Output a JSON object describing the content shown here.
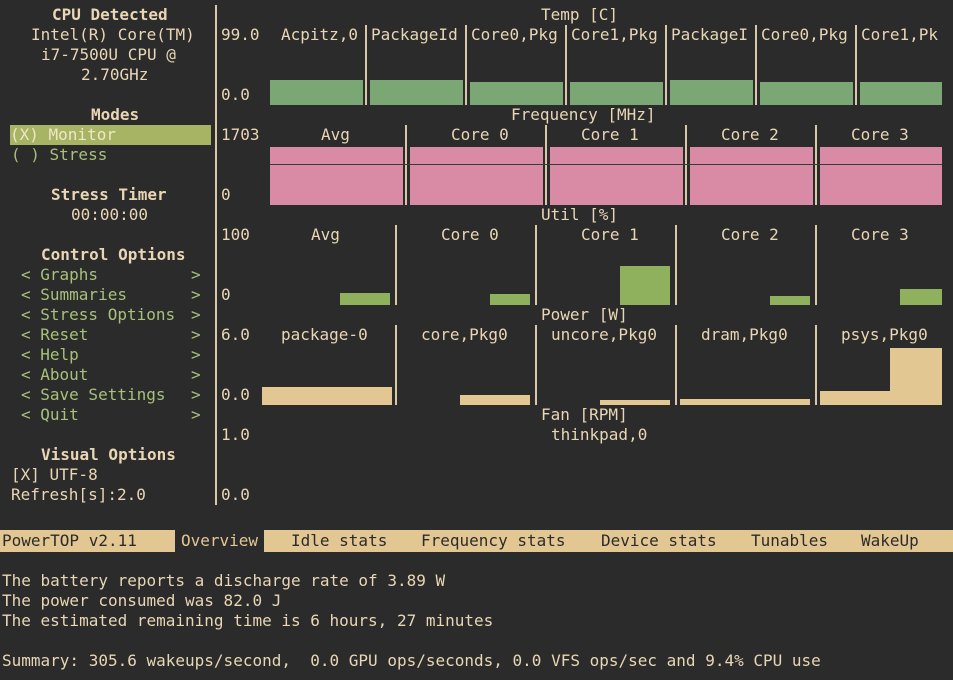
{
  "sidebar": {
    "cpu_title": "CPU Detected",
    "cpu_lines": [
      "Intel(R) Core(TM)",
      "i7-7500U CPU @",
      "2.70GHz"
    ],
    "modes_title": "Modes",
    "mode_monitor": "(X) Monitor",
    "mode_stress": "( ) Stress",
    "stress_timer_title": "Stress Timer",
    "stress_timer_value": "00:00:00",
    "control_title": "Control Options",
    "control_items": [
      "Graphs",
      "Summaries",
      "Stress Options",
      "Reset",
      "Help",
      "About",
      "Save Settings",
      "Quit"
    ],
    "visual_title": "Visual Options",
    "utf8": "[X] UTF-8",
    "refresh": "Refresh[s]:2.0"
  },
  "graphs": {
    "temp": {
      "title": "Temp [C]",
      "max": "99.0",
      "min": "0.0",
      "labels": [
        "Acpitz,0",
        "PackageId",
        "Core0,Pkg",
        "Core1,Pkg",
        "PackageI",
        "Core0,Pkg",
        "Core1,Pk"
      ],
      "color": "#7ba774"
    },
    "freq": {
      "title": "Frequency [MHz]",
      "max": "1703",
      "min": "0",
      "labels": [
        "Avg",
        "Core 0",
        "Core 1",
        "Core 2",
        "Core 3"
      ],
      "color": "#d98aa4"
    },
    "util": {
      "title": "Util [%]",
      "max": "100",
      "min": "0",
      "labels": [
        "Avg",
        "Core 0",
        "Core 1",
        "Core 2",
        "Core 3"
      ],
      "color": "#8fb05c"
    },
    "power": {
      "title": "Power [W]",
      "max": "6.0",
      "min": "0.0",
      "labels": [
        "package-0",
        "core,Pkg0",
        "uncore,Pkg0",
        "dram,Pkg0",
        "psys,Pkg0"
      ],
      "color": "#e3c793"
    },
    "fan": {
      "title": "Fan [RPM]",
      "max": "1.0",
      "min": "0.0",
      "labels": [
        "thinkpad,0"
      ]
    }
  },
  "powertop": {
    "version": "PowerTOP v2.11",
    "tabs": [
      "Overview",
      "Idle stats",
      "Frequency stats",
      "Device stats",
      "Tunables",
      "WakeUp"
    ],
    "active_tab": "Overview",
    "lines": [
      "The battery reports a discharge rate of 3.89 W",
      "The power consumed was 82.0 J",
      "The estimated remaining time is 6 hours, 27 minutes"
    ],
    "summary": "Summary: 305.6 wakeups/second,  0.0 GPU ops/seconds, 0.0 VFS ops/sec and 9.4% CPU use"
  }
}
